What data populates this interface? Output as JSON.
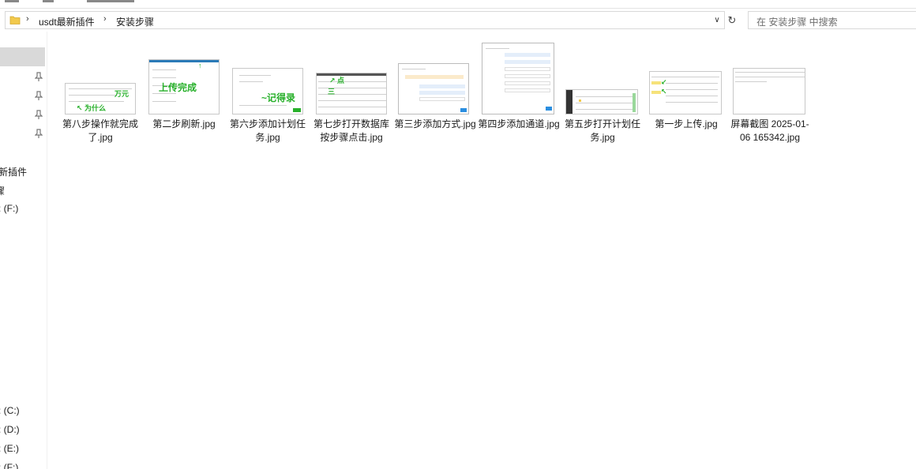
{
  "address_bar": {
    "breadcrumbs": [
      "usdt最新插件",
      "安装步骤"
    ]
  },
  "search": {
    "placeholder": "在 安装步骤 中搜索"
  },
  "nav_pane": {
    "items": [
      "新插件",
      "骤",
      ": (F:)",
      ": (C:)",
      ": (D:)",
      ": (E:)",
      ": (F:)"
    ]
  },
  "files": [
    {
      "name": "第八步操作就完成了.jpg"
    },
    {
      "name": "第二步刷新.jpg"
    },
    {
      "name": "第六步添加计划任务.jpg"
    },
    {
      "name": "第七步打开数据库按步骤点击.jpg"
    },
    {
      "name": "第三步添加方式.jpg"
    },
    {
      "name": "第四步添加通道.jpg"
    },
    {
      "name": "第五步打开计划任务.jpg"
    },
    {
      "name": "第一步上传.jpg"
    },
    {
      "name": "屏幕截图 2025-01-06 165342.jpg"
    }
  ],
  "colors": {
    "accent_green": "#27b02a",
    "selection": "#d9d9d9"
  }
}
